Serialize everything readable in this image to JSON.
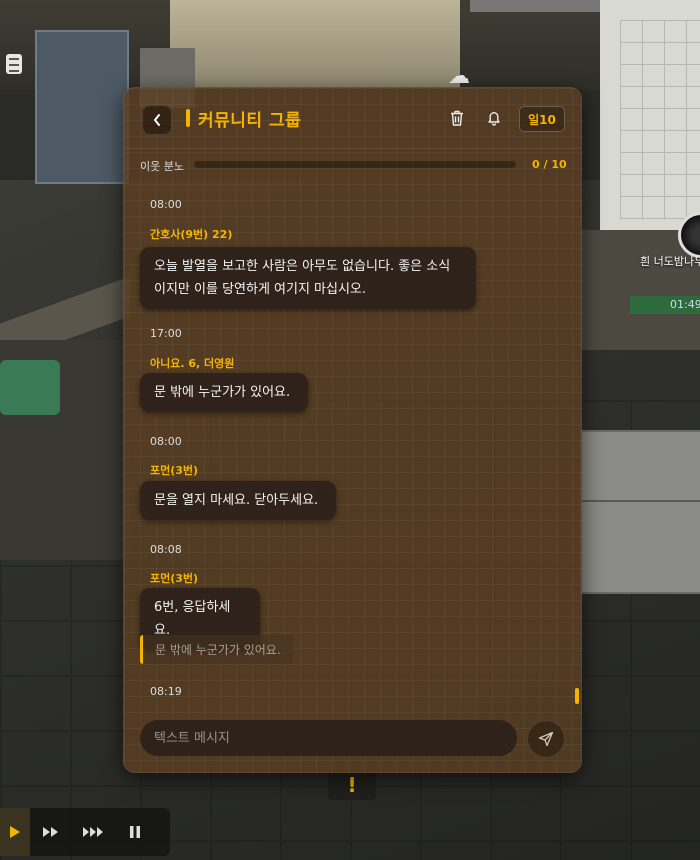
{
  "header": {
    "title": "커뮤니티 그룹",
    "day_badge": "일10",
    "icons": [
      "back-arrow-icon",
      "trash-icon",
      "bell-icon"
    ]
  },
  "anger": {
    "label": "이웃 분노",
    "current": 0,
    "max": 10,
    "count_text": "0 / 10"
  },
  "messages": [
    {
      "time": "08:00",
      "sender": "간호사(9번) 22)",
      "lines": [
        "오늘 발열을 보고한 사람은 아무도 없습니다. 좋은 소식",
        "이지만 이를 당연하게 여기지 마십시오."
      ]
    },
    {
      "time": "17:00",
      "sender": "아니요. 6, 더영원",
      "lines": [
        "문 밖에 누군가가 있어요."
      ]
    },
    {
      "time": "08:00",
      "sender": "포먼(3번)",
      "lines": [
        "문을 열지 마세요. 닫아두세요."
      ]
    },
    {
      "time": "08:08",
      "sender": "포먼(3번)",
      "lines": [
        "6번, 응답하세요."
      ],
      "quote": "문 밖에 누군가가 있어요."
    },
    {
      "time": "08:19"
    }
  ],
  "input": {
    "placeholder": "텍스트 메시지",
    "value": ""
  },
  "side_hud": {
    "right_label": "흰 너도밤나무",
    "right_timer": "01:49",
    "alert": "!"
  },
  "playback": [
    "play",
    "fast-forward",
    "faster-forward",
    "pause"
  ],
  "colors": {
    "accent": "#f5b400",
    "panel": "#583e22",
    "bubble": "#2e221a"
  }
}
